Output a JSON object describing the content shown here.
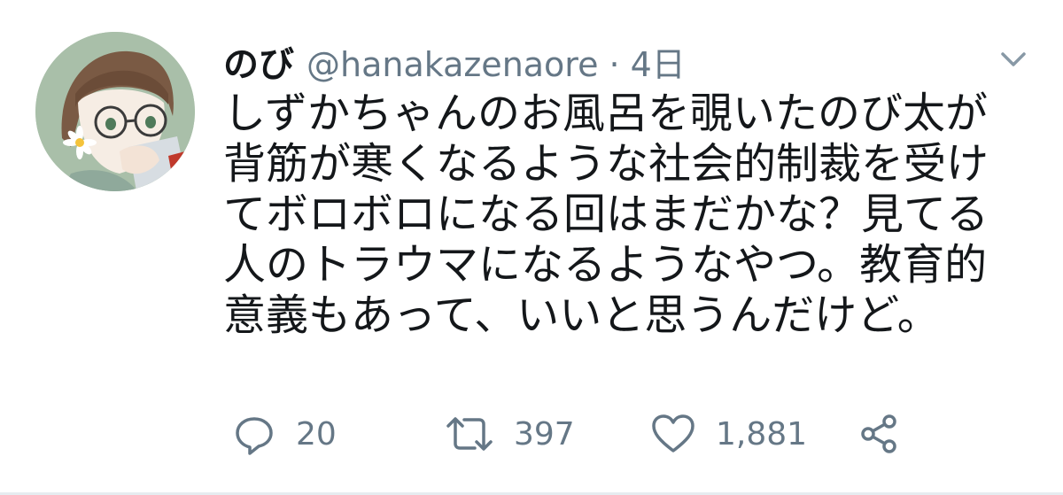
{
  "tweet": {
    "display_name": "のび",
    "handle": "@hanakazenaore",
    "separator": "·",
    "time": "4日",
    "text_lines": [
      "しずかちゃんのお風呂を覗いたのび太が",
      "背筋が寒くなるような社会的制裁を受け",
      "てボロボロになる回はまだかな？見てる",
      "人のトラウマになるようなやつ。教育的",
      "意義もあって、いいと思うんだけど。"
    ],
    "actions": {
      "reply_count": "20",
      "retweet_count": "397",
      "like_count": "1,881"
    }
  },
  "icons": {
    "menu": "chevron-down-icon",
    "reply": "reply-icon",
    "retweet": "retweet-icon",
    "like": "heart-icon",
    "share": "share-icon"
  },
  "colors": {
    "text": "#14171a",
    "secondary": "#657786",
    "divider": "#e6ecf0"
  }
}
